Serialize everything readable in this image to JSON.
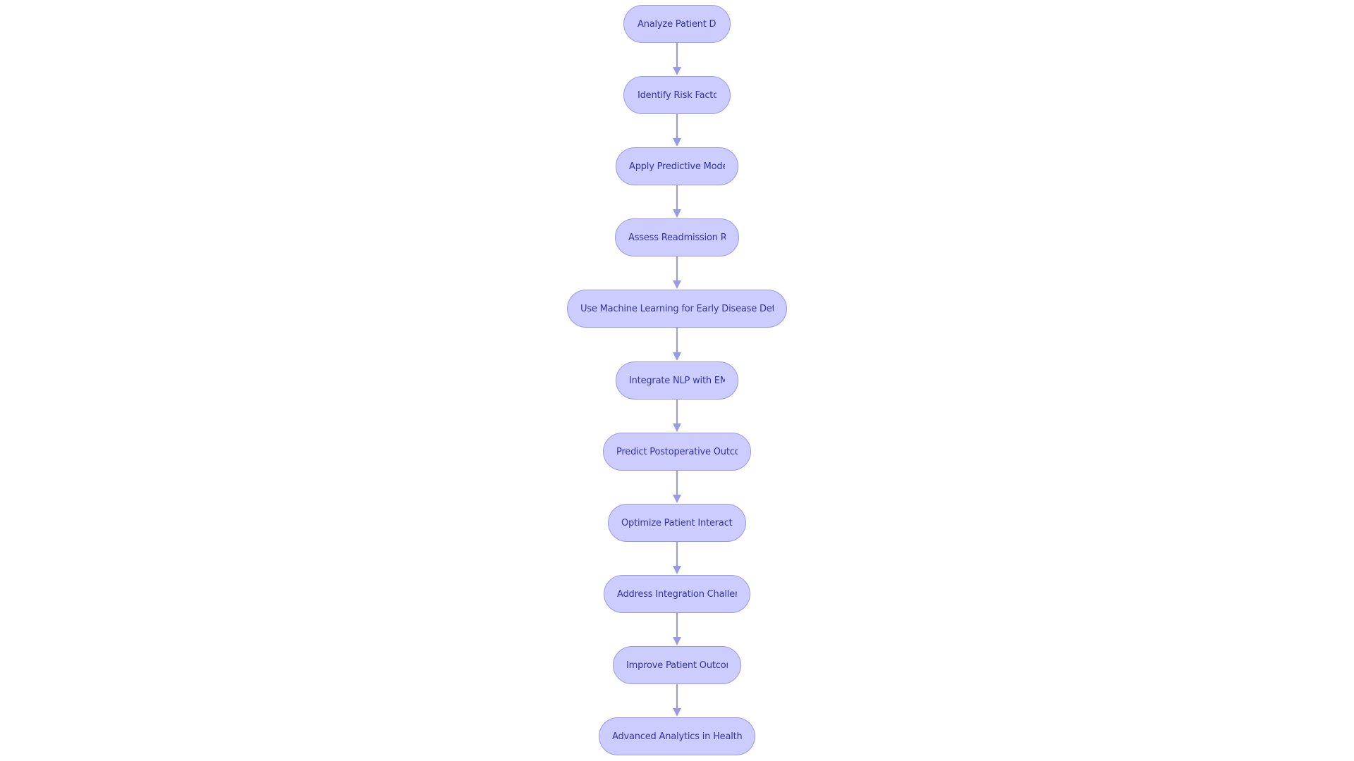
{
  "diagram": {
    "type": "flowchart",
    "direction": "top-to-bottom",
    "colors": {
      "node_fill": "#CCCCFF",
      "node_border": "#9999EE",
      "node_text": "#3333AA",
      "edge": "#9999E6",
      "background": "#FFFFFF"
    },
    "nodes": [
      {
        "id": "n1",
        "label": "Analyze Patient Da"
      },
      {
        "id": "n2",
        "label": "Identify Risk Facto"
      },
      {
        "id": "n3",
        "label": "Apply Predictive Mode"
      },
      {
        "id": "n4",
        "label": "Assess Readmission Ri"
      },
      {
        "id": "n5",
        "label": "Use Machine Learning for Early Disease Detec"
      },
      {
        "id": "n6",
        "label": "Integrate NLP with EM"
      },
      {
        "id": "n7",
        "label": "Predict Postoperative Outcc"
      },
      {
        "id": "n8",
        "label": "Optimize Patient Interacti"
      },
      {
        "id": "n9",
        "label": "Address Integration Challen"
      },
      {
        "id": "n10",
        "label": "Improve Patient Outcon"
      },
      {
        "id": "n11",
        "label": "Advanced Analytics in Healthc"
      }
    ],
    "edges": [
      {
        "from": "n1",
        "to": "n2"
      },
      {
        "from": "n2",
        "to": "n3"
      },
      {
        "from": "n3",
        "to": "n4"
      },
      {
        "from": "n4",
        "to": "n5"
      },
      {
        "from": "n5",
        "to": "n6"
      },
      {
        "from": "n6",
        "to": "n7"
      },
      {
        "from": "n7",
        "to": "n8"
      },
      {
        "from": "n8",
        "to": "n9"
      },
      {
        "from": "n9",
        "to": "n10"
      },
      {
        "from": "n10",
        "to": "n11"
      }
    ]
  }
}
